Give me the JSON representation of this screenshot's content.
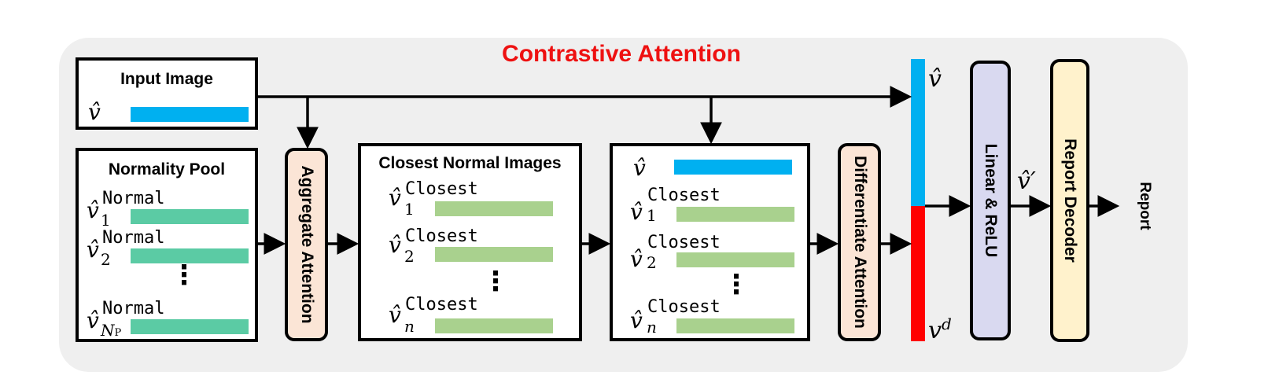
{
  "title": "Contrastive Attention",
  "input_image": {
    "label": "Input Image",
    "var": "v̂"
  },
  "normality_pool": {
    "label": "Normality Pool",
    "var": "v̂",
    "sup": "Normal",
    "subs": [
      "1",
      "2",
      "N",
      "P"
    ],
    "dots": "⋮"
  },
  "aggregate_attention": {
    "label": "Aggregate Attention"
  },
  "closest_normal_images": {
    "label": "Closest Normal Images",
    "var": "v̂",
    "sup": "Closest",
    "subs": [
      "1",
      "2",
      "n"
    ],
    "dots": "⋮"
  },
  "combined_box": {
    "var": "v̂",
    "sup": "Closest",
    "subs": [
      "1",
      "2",
      "n"
    ],
    "dots": "⋮"
  },
  "differentiate_attention": {
    "label": "Differentiate Attention"
  },
  "concat": {
    "top_label": "v̂",
    "bottom_label": "v",
    "bottom_sup": "d"
  },
  "linear_relu": {
    "label": "Linear & ReLU"
  },
  "v_prime": "v̂′",
  "report_decoder": {
    "label": "Report Decoder"
  },
  "report": "Report",
  "colors": {
    "title": "#ee1111",
    "panel": "#efefef",
    "blue_bar": "#00b0f0",
    "teal_bar": "#5bcba4",
    "green_bar": "#a9d18e",
    "red_bar": "#ff0000",
    "attention_fill": "#fbe5d6",
    "linear_fill": "#d9d9f0",
    "decoder_fill": "#fff2cc"
  }
}
